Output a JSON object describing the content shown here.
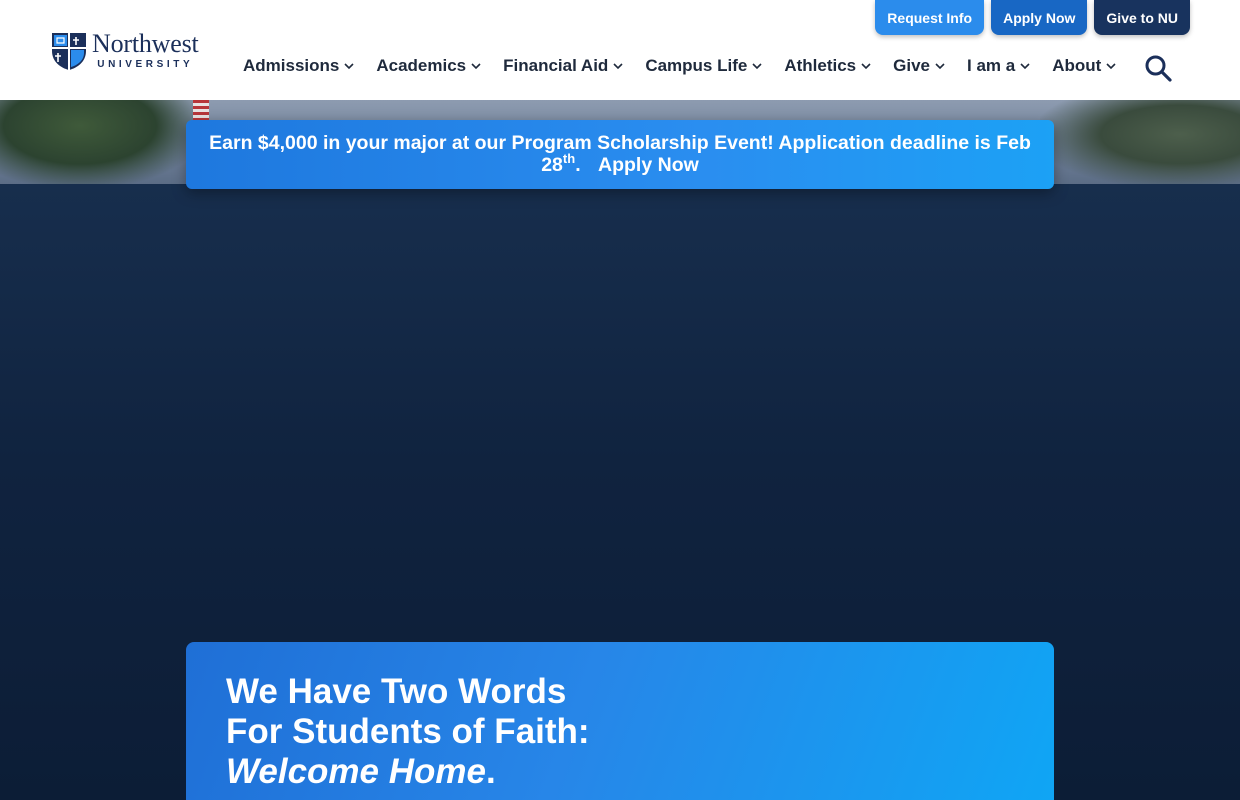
{
  "brand": {
    "name": "Northwest",
    "sub": "UNIVERSITY",
    "logo_icon": "shield-crest-icon",
    "color_navy": "#1b2f5a"
  },
  "utility_nav": [
    {
      "label": "Request Info",
      "color": "#2b8cec"
    },
    {
      "label": "Apply Now",
      "color": "#1867c4"
    },
    {
      "label": "Give to NU",
      "color": "#18335e"
    }
  ],
  "nav": {
    "items": [
      {
        "label": "Admissions"
      },
      {
        "label": "Academics"
      },
      {
        "label": "Financial Aid"
      },
      {
        "label": "Campus Life"
      },
      {
        "label": "Athletics"
      },
      {
        "label": "Give"
      },
      {
        "label": "I am a"
      },
      {
        "label": "About"
      }
    ],
    "dropdown_icon": "chevron-down-icon",
    "search_icon": "search-icon"
  },
  "banner": {
    "text_before": "Earn $4,000 in your major at our Program Scholarship Event! Application deadline is Feb 28",
    "superscript": "th",
    "text_after": ".",
    "link_label": "Apply Now",
    "color": "#2a8ef0"
  },
  "welcome": {
    "line1": "We Have Two Words",
    "line2": "For Students of Faith:",
    "line3_emphasis": "Welcome Home",
    "line3_punct": "."
  }
}
